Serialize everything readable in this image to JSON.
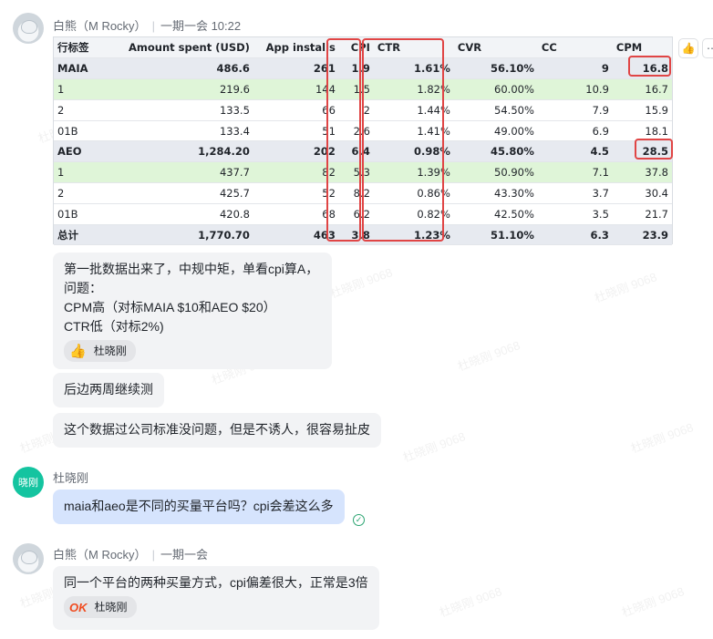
{
  "messages": [
    {
      "sender": "白熊（M Rocky）",
      "time": "一期一会  10:22"
    },
    {
      "sender": "杜晓刚"
    },
    {
      "sender": "白熊（M Rocky）",
      "time": "一期一会"
    }
  ],
  "avatar_label": "晓刚",
  "table": {
    "headers": [
      "行标签",
      "Amount spent (USD)",
      "App installs",
      "CPI",
      "CTR",
      "CVR",
      "CC",
      "CPM"
    ],
    "rows": [
      [
        "MAIA",
        "486.6",
        "261",
        "1.9",
        "1.61%",
        "56.10%",
        "9",
        "16.8"
      ],
      [
        "1",
        "219.6",
        "144",
        "1.5",
        "1.82%",
        "60.00%",
        "10.9",
        "16.7"
      ],
      [
        "2",
        "133.5",
        "66",
        "2",
        "1.44%",
        "54.50%",
        "7.9",
        "15.9"
      ],
      [
        "01B",
        "133.4",
        "51",
        "2.6",
        "1.41%",
        "49.00%",
        "6.9",
        "18.1"
      ],
      [
        "AEO",
        "1,284.20",
        "202",
        "6.4",
        "0.98%",
        "45.80%",
        "4.5",
        "28.5"
      ],
      [
        "1",
        "437.7",
        "82",
        "5.3",
        "1.39%",
        "50.90%",
        "7.1",
        "37.8"
      ],
      [
        "2",
        "425.7",
        "52",
        "8.2",
        "0.86%",
        "43.30%",
        "3.7",
        "30.4"
      ],
      [
        "01B",
        "420.8",
        "68",
        "6.2",
        "0.82%",
        "42.50%",
        "3.5",
        "21.7"
      ],
      [
        "总计",
        "1,770.70",
        "463",
        "3.8",
        "1.23%",
        "51.10%",
        "6.3",
        "23.9"
      ]
    ],
    "row_styles": [
      "group",
      "green",
      "",
      "",
      "group",
      "green",
      "",
      "",
      "total"
    ]
  },
  "bubbles": {
    "m1_line1": "第一批数据出来了，中规中矩，单看cpi算A，",
    "m1_line2": "问题：",
    "m1_line3": "CPM高（对标MAIA  $10和AEO   $20）",
    "m1_line4": "CTR低（对标2%)",
    "m1_reaction": "杜晓刚",
    "m2": "后边两周继续测",
    "m3": "这个数据过公司标准没问题，但是不诱人，很容易扯皮",
    "m4": "maia和aeo是不同的买量平台吗？cpi会差这么多",
    "m5": "同一个平台的两种买量方式，cpi偏差很大，正常是3倍",
    "m5_reaction": "杜晓刚",
    "m5_reaction_icon": "OK"
  },
  "watermark": "杜晓刚 9068",
  "colors": {
    "red_box": "#e04545",
    "green_row": "#dff5d8",
    "bubble_blue": "#d6e4fd"
  }
}
